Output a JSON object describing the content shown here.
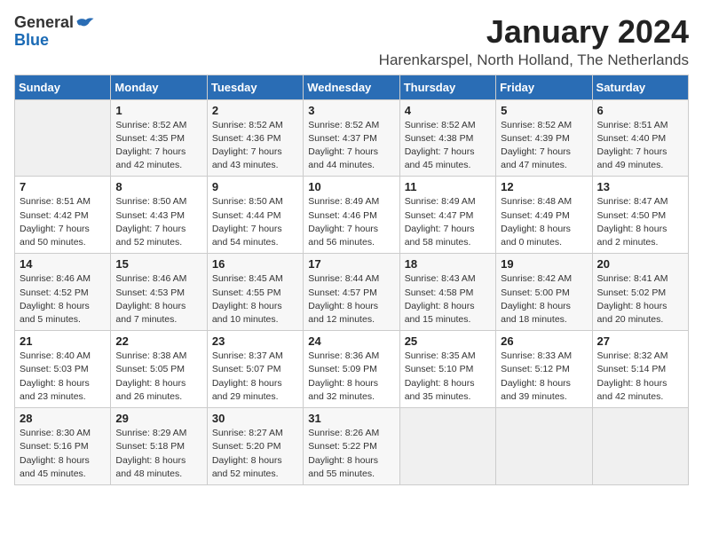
{
  "logo": {
    "general": "General",
    "blue": "Blue"
  },
  "title": "January 2024",
  "location": "Harenkarspel, North Holland, The Netherlands",
  "days_of_week": [
    "Sunday",
    "Monday",
    "Tuesday",
    "Wednesday",
    "Thursday",
    "Friday",
    "Saturday"
  ],
  "weeks": [
    [
      {
        "day": "",
        "info": ""
      },
      {
        "day": "1",
        "info": "Sunrise: 8:52 AM\nSunset: 4:35 PM\nDaylight: 7 hours\nand 42 minutes."
      },
      {
        "day": "2",
        "info": "Sunrise: 8:52 AM\nSunset: 4:36 PM\nDaylight: 7 hours\nand 43 minutes."
      },
      {
        "day": "3",
        "info": "Sunrise: 8:52 AM\nSunset: 4:37 PM\nDaylight: 7 hours\nand 44 minutes."
      },
      {
        "day": "4",
        "info": "Sunrise: 8:52 AM\nSunset: 4:38 PM\nDaylight: 7 hours\nand 45 minutes."
      },
      {
        "day": "5",
        "info": "Sunrise: 8:52 AM\nSunset: 4:39 PM\nDaylight: 7 hours\nand 47 minutes."
      },
      {
        "day": "6",
        "info": "Sunrise: 8:51 AM\nSunset: 4:40 PM\nDaylight: 7 hours\nand 49 minutes."
      }
    ],
    [
      {
        "day": "7",
        "info": "Sunrise: 8:51 AM\nSunset: 4:42 PM\nDaylight: 7 hours\nand 50 minutes."
      },
      {
        "day": "8",
        "info": "Sunrise: 8:50 AM\nSunset: 4:43 PM\nDaylight: 7 hours\nand 52 minutes."
      },
      {
        "day": "9",
        "info": "Sunrise: 8:50 AM\nSunset: 4:44 PM\nDaylight: 7 hours\nand 54 minutes."
      },
      {
        "day": "10",
        "info": "Sunrise: 8:49 AM\nSunset: 4:46 PM\nDaylight: 7 hours\nand 56 minutes."
      },
      {
        "day": "11",
        "info": "Sunrise: 8:49 AM\nSunset: 4:47 PM\nDaylight: 7 hours\nand 58 minutes."
      },
      {
        "day": "12",
        "info": "Sunrise: 8:48 AM\nSunset: 4:49 PM\nDaylight: 8 hours\nand 0 minutes."
      },
      {
        "day": "13",
        "info": "Sunrise: 8:47 AM\nSunset: 4:50 PM\nDaylight: 8 hours\nand 2 minutes."
      }
    ],
    [
      {
        "day": "14",
        "info": "Sunrise: 8:46 AM\nSunset: 4:52 PM\nDaylight: 8 hours\nand 5 minutes."
      },
      {
        "day": "15",
        "info": "Sunrise: 8:46 AM\nSunset: 4:53 PM\nDaylight: 8 hours\nand 7 minutes."
      },
      {
        "day": "16",
        "info": "Sunrise: 8:45 AM\nSunset: 4:55 PM\nDaylight: 8 hours\nand 10 minutes."
      },
      {
        "day": "17",
        "info": "Sunrise: 8:44 AM\nSunset: 4:57 PM\nDaylight: 8 hours\nand 12 minutes."
      },
      {
        "day": "18",
        "info": "Sunrise: 8:43 AM\nSunset: 4:58 PM\nDaylight: 8 hours\nand 15 minutes."
      },
      {
        "day": "19",
        "info": "Sunrise: 8:42 AM\nSunset: 5:00 PM\nDaylight: 8 hours\nand 18 minutes."
      },
      {
        "day": "20",
        "info": "Sunrise: 8:41 AM\nSunset: 5:02 PM\nDaylight: 8 hours\nand 20 minutes."
      }
    ],
    [
      {
        "day": "21",
        "info": "Sunrise: 8:40 AM\nSunset: 5:03 PM\nDaylight: 8 hours\nand 23 minutes."
      },
      {
        "day": "22",
        "info": "Sunrise: 8:38 AM\nSunset: 5:05 PM\nDaylight: 8 hours\nand 26 minutes."
      },
      {
        "day": "23",
        "info": "Sunrise: 8:37 AM\nSunset: 5:07 PM\nDaylight: 8 hours\nand 29 minutes."
      },
      {
        "day": "24",
        "info": "Sunrise: 8:36 AM\nSunset: 5:09 PM\nDaylight: 8 hours\nand 32 minutes."
      },
      {
        "day": "25",
        "info": "Sunrise: 8:35 AM\nSunset: 5:10 PM\nDaylight: 8 hours\nand 35 minutes."
      },
      {
        "day": "26",
        "info": "Sunrise: 8:33 AM\nSunset: 5:12 PM\nDaylight: 8 hours\nand 39 minutes."
      },
      {
        "day": "27",
        "info": "Sunrise: 8:32 AM\nSunset: 5:14 PM\nDaylight: 8 hours\nand 42 minutes."
      }
    ],
    [
      {
        "day": "28",
        "info": "Sunrise: 8:30 AM\nSunset: 5:16 PM\nDaylight: 8 hours\nand 45 minutes."
      },
      {
        "day": "29",
        "info": "Sunrise: 8:29 AM\nSunset: 5:18 PM\nDaylight: 8 hours\nand 48 minutes."
      },
      {
        "day": "30",
        "info": "Sunrise: 8:27 AM\nSunset: 5:20 PM\nDaylight: 8 hours\nand 52 minutes."
      },
      {
        "day": "31",
        "info": "Sunrise: 8:26 AM\nSunset: 5:22 PM\nDaylight: 8 hours\nand 55 minutes."
      },
      {
        "day": "",
        "info": ""
      },
      {
        "day": "",
        "info": ""
      },
      {
        "day": "",
        "info": ""
      }
    ]
  ]
}
